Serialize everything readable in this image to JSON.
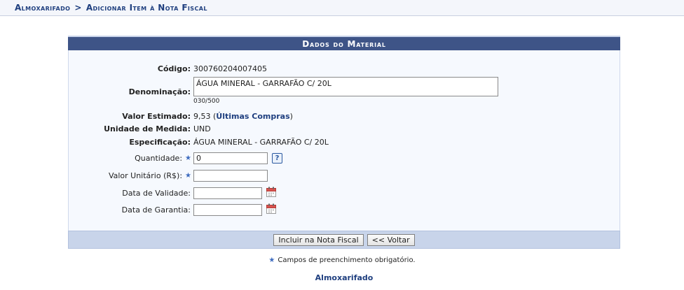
{
  "breadcrumb": {
    "section": "Almoxarifado",
    "separator": ">",
    "page": "Adicionar Item à Nota Fiscal"
  },
  "panel": {
    "title": "Dados do Material",
    "codigo_label": "Código:",
    "codigo_value": "300760204007405",
    "denominacao_label": "Denominação:",
    "denominacao_value": "ÁGUA MINERAL - GARRAFÃO C/ 20L",
    "denominacao_counter": "030/500",
    "valor_estimado_label": "Valor Estimado:",
    "valor_estimado_value": "9,53",
    "valor_estimado_open": " (",
    "ultimas_compras_link": "Últimas Compras",
    "valor_estimado_close": ")",
    "unidade_label": "Unidade de Medida:",
    "unidade_value": "UND",
    "especificacao_label": "Especificação:",
    "especificacao_value": "ÁGUA MINERAL - GARRAFÃO C/ 20L",
    "quantidade_label": "Quantidade:",
    "quantidade_value": "0",
    "valor_unitario_label": "Valor Unitário (R$):",
    "valor_unitario_value": "",
    "data_validade_label": "Data de Validade:",
    "data_validade_value": "",
    "data_garantia_label": "Data de Garantia:",
    "data_garantia_value": "",
    "required_marker": "★",
    "help_icon_text": "?"
  },
  "buttons": {
    "incluir": "Incluir na Nota Fiscal",
    "voltar": "<< Voltar"
  },
  "note": {
    "text": "Campos de preenchimento obrigatório."
  },
  "footer": {
    "link": "Almoxarifado"
  },
  "icons": {
    "required": "star-icon",
    "help": "help-icon",
    "calendar": "calendar-icon"
  },
  "colors": {
    "panel_title_bg": "#3e5487",
    "panel_body_bg": "#f6f9fe",
    "footer_bar_bg": "#c8d4ea",
    "link": "#1f3f7f",
    "required_star": "#3d6bbf"
  }
}
